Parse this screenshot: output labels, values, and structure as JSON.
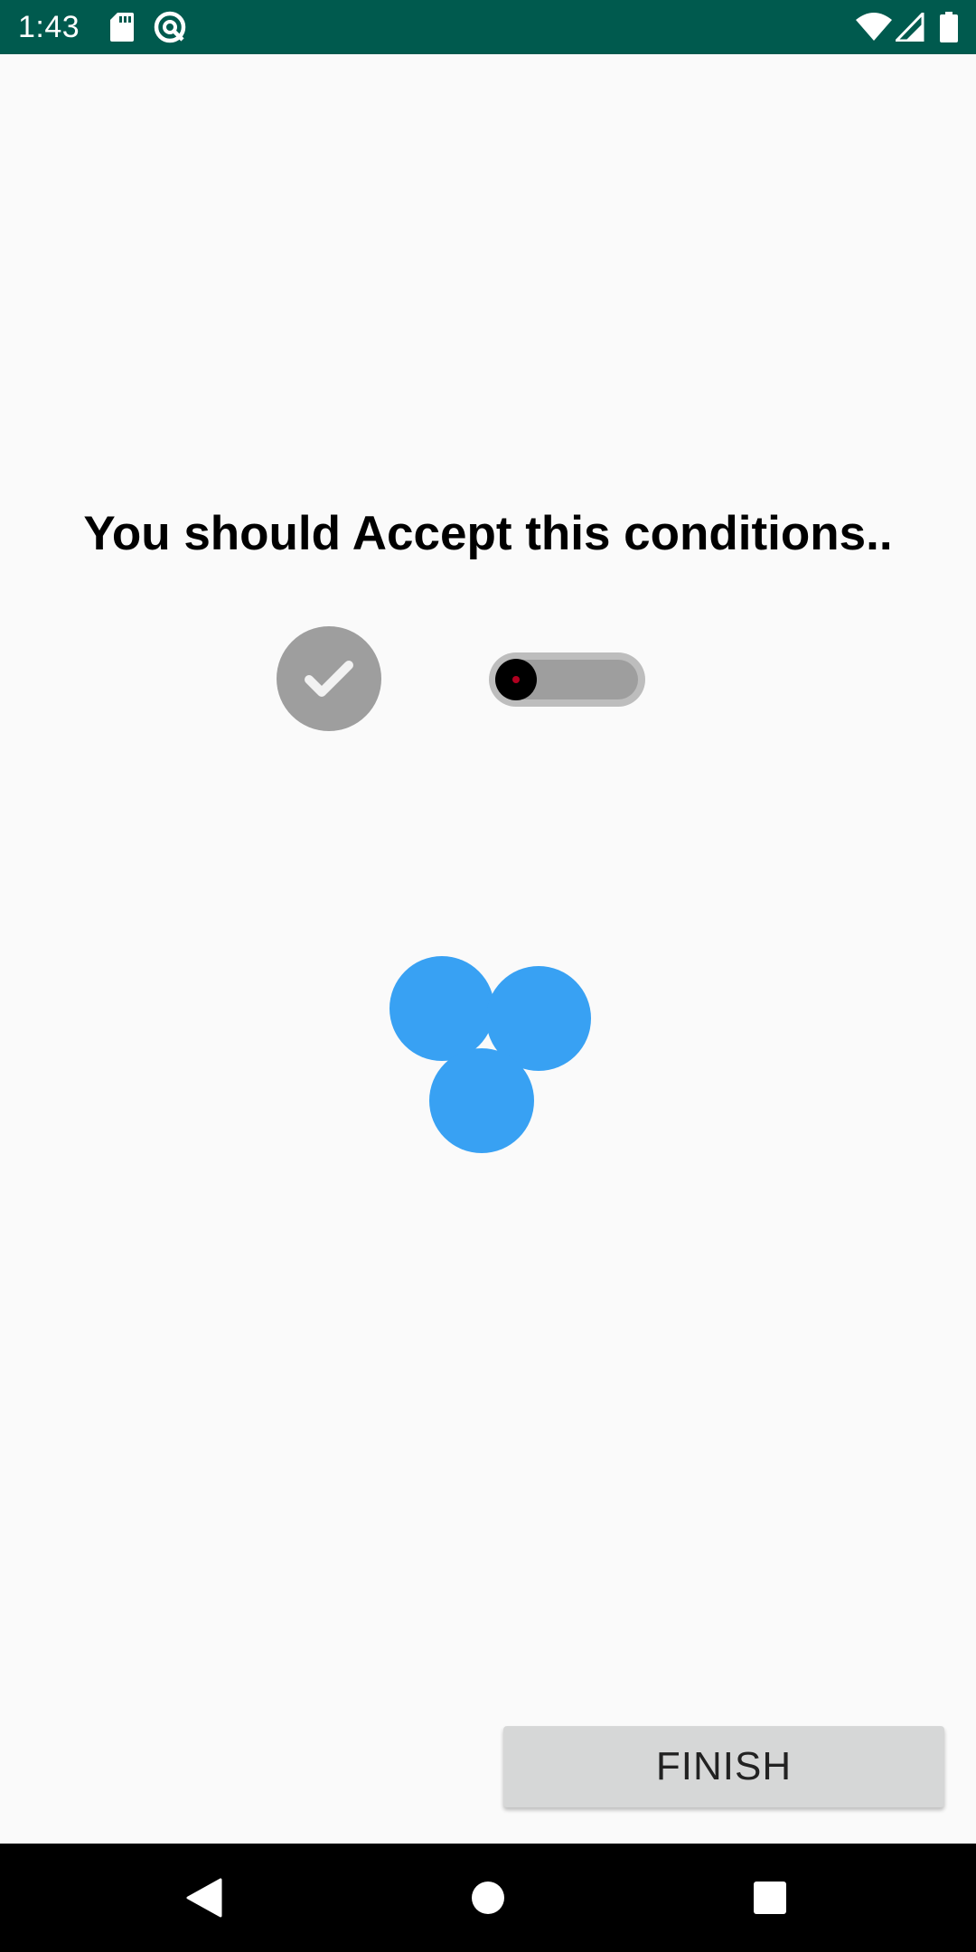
{
  "status_bar": {
    "time": "1:43",
    "background": "#005A4E",
    "icons": [
      "sd-card-icon",
      "data-saver-icon",
      "wifi-icon",
      "cell-signal-icon",
      "battery-icon"
    ]
  },
  "main": {
    "title": "You should Accept this conditions..",
    "checkbox_checked": true,
    "switch_on": false,
    "loader_color": "#38A1F3"
  },
  "actions": {
    "finish_label": "FINISH"
  },
  "nav_bar": {
    "icons": [
      "back-icon",
      "home-icon",
      "recents-icon"
    ]
  }
}
